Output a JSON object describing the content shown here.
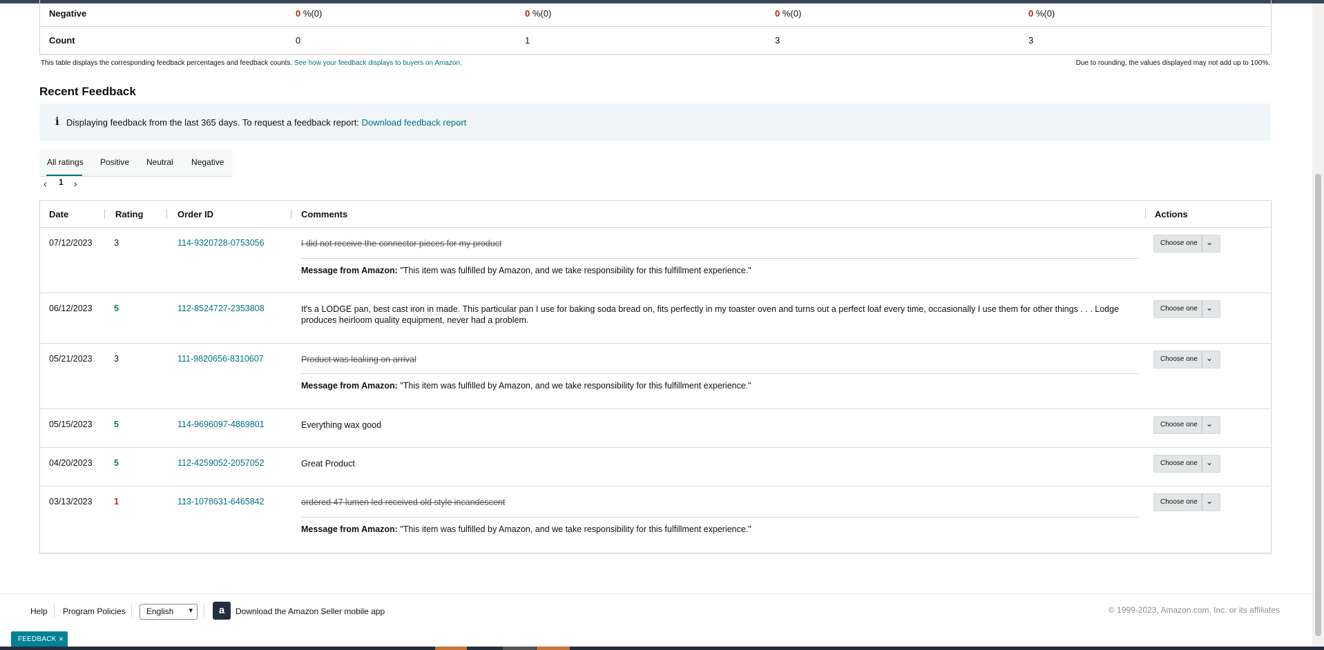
{
  "summary": {
    "rows": [
      {
        "label": "Negative",
        "cells": [
          {
            "val": "0",
            "suffix": " %(0)"
          },
          {
            "val": "0",
            "suffix": " %(0)"
          },
          {
            "val": "0",
            "suffix": " %(0)"
          },
          {
            "val": "0",
            "suffix": " %(0)"
          }
        ]
      },
      {
        "label": "Count",
        "cells": [
          {
            "val": "0"
          },
          {
            "val": "1"
          },
          {
            "val": "3"
          },
          {
            "val": "3"
          }
        ]
      }
    ],
    "note": "This table displays the corresponding feedback percentages and feedback counts.",
    "note_link": "See how your feedback displays to buyers on Amazon.",
    "rounding_note": "Due to rounding, the values displayed may not add up to 100%."
  },
  "recent": {
    "title": "Recent Feedback",
    "info_icon": "i",
    "info_text": "Displaying feedback from the last 365 days. To request a feedback report:",
    "info_link": "Download feedback report",
    "tabs": [
      "All ratings",
      "Positive",
      "Neutral",
      "Negative"
    ],
    "pager": {
      "prev": "‹",
      "page": "1",
      "next": "›"
    }
  },
  "table": {
    "headers": {
      "date": "Date",
      "rating": "Rating",
      "order": "Order ID",
      "comments": "Comments",
      "actions": "Actions"
    },
    "action_label": "Choose one",
    "amazon_label": "Message from Amazon:",
    "amazon_text": " \"This item was fulfilled by Amazon, and we take responsibility for this fulfillment experience.\"",
    "rows": [
      {
        "date": "07/12/2023",
        "rating": "3",
        "order": "114-9320728-0753056",
        "comment": "I did not receive the connector pieces for my product"
      },
      {
        "date": "06/12/2023",
        "rating": "5",
        "order": "112-8524727-2353808",
        "comment": "It's a LODGE pan, best cast iron in made. This particular pan I use for baking soda bread on, fits perfectly in my toaster oven and turns out a perfect loaf every time, occasionally I use them for other things . . . Lodge produces heirloom quality equipment, never had a problem."
      },
      {
        "date": "05/21/2023",
        "rating": "3",
        "order": "111-9820656-8310607",
        "comment": "Product was leaking on arrival"
      },
      {
        "date": "05/15/2023",
        "rating": "5",
        "order": "114-9696097-4869801",
        "comment": "Everything wax good"
      },
      {
        "date": "04/20/2023",
        "rating": "5",
        "order": "112-4259052-2057052",
        "comment": "Great Product"
      },
      {
        "date": "03/13/2023",
        "rating": "1",
        "order": "113-1078631-6465842",
        "comment": "ordered 47 lumen led received old style incandescent"
      }
    ]
  },
  "footer": {
    "help": "Help",
    "policies": "Program Policies",
    "language": "English",
    "app_icon": "a",
    "app_text": "Download the Amazon Seller mobile app",
    "copyright": "© 1999-2023, Amazon.com, Inc. or its affiliates"
  },
  "feedback_badge": {
    "label": "FEEDBACK",
    "close": "×"
  },
  "colors": {
    "link": "#007185",
    "positive": "#067d62",
    "negative": "#b12704",
    "badge": "#008296"
  }
}
